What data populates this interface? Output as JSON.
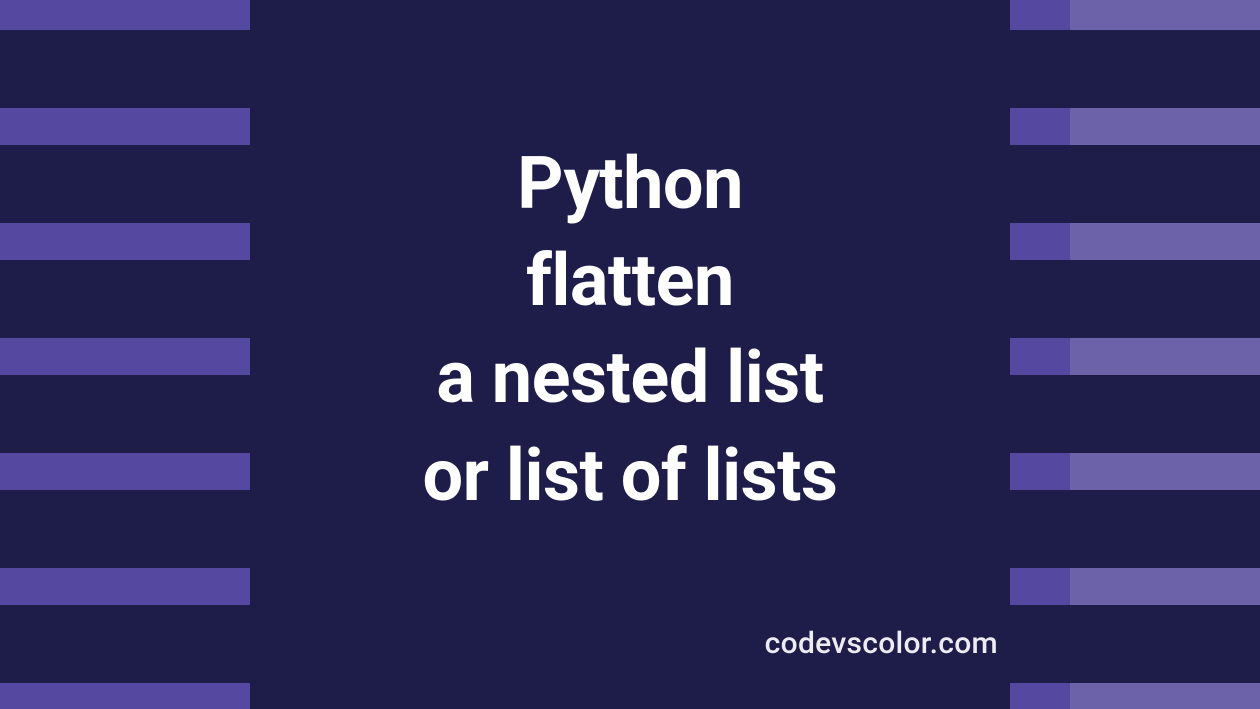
{
  "title": {
    "line1": "Python",
    "line2": "flatten",
    "line3": "a nested list",
    "line4": "or list of lists"
  },
  "watermark": "codevscolor.com",
  "colors": {
    "bg_left": "#5448a0",
    "bg_center": "#1e1d4a",
    "bg_right": "#6b62a9",
    "text": "#ffffff"
  }
}
